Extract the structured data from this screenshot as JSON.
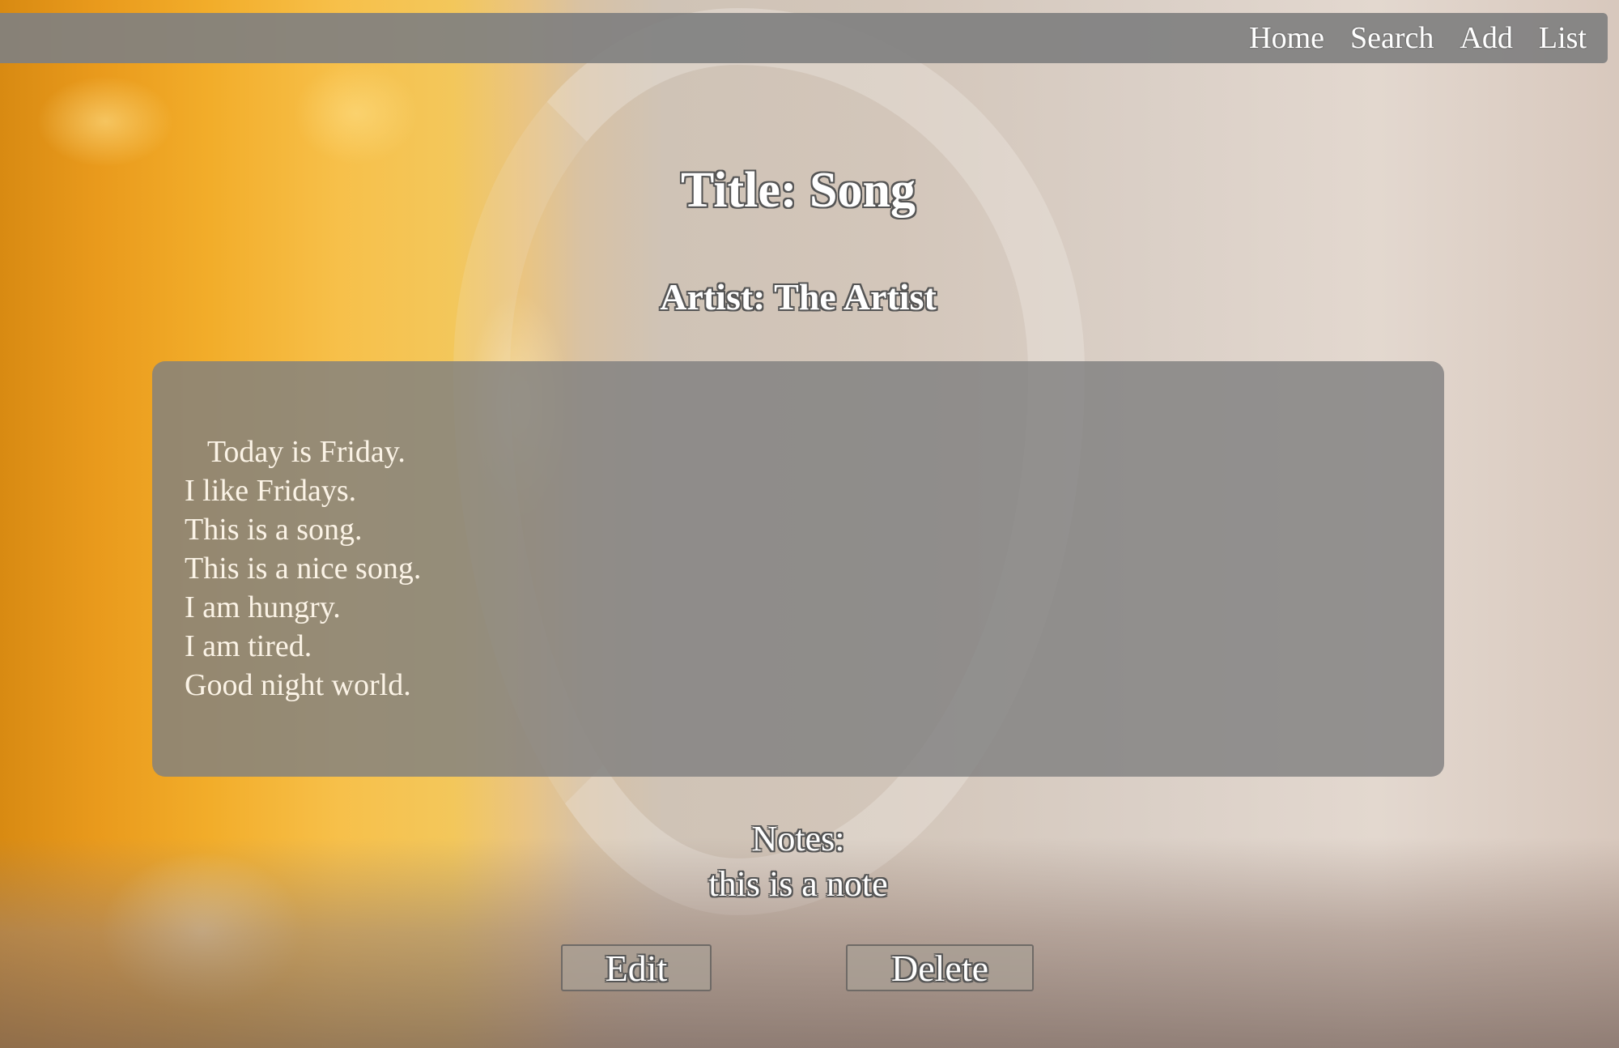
{
  "nav": {
    "items": [
      {
        "label": "Home"
      },
      {
        "label": "Search"
      },
      {
        "label": "Add"
      },
      {
        "label": "List"
      }
    ]
  },
  "song": {
    "title": "Title: Song",
    "artist": "Artist: The Artist",
    "lyrics": "   Today is Friday.\nI like Fridays.\nThis is a song.\nThis is a nice song.\nI am hungry.\nI am tired.\nGood night world.",
    "notes_label": "Notes:",
    "notes_value": "this is a note"
  },
  "actions": {
    "edit_label": "Edit",
    "delete_label": "Delete"
  },
  "colors": {
    "navbar_bg": "#808080",
    "panel_bg": "#808080",
    "text": "#ffffff",
    "text_outline": "#555555"
  }
}
